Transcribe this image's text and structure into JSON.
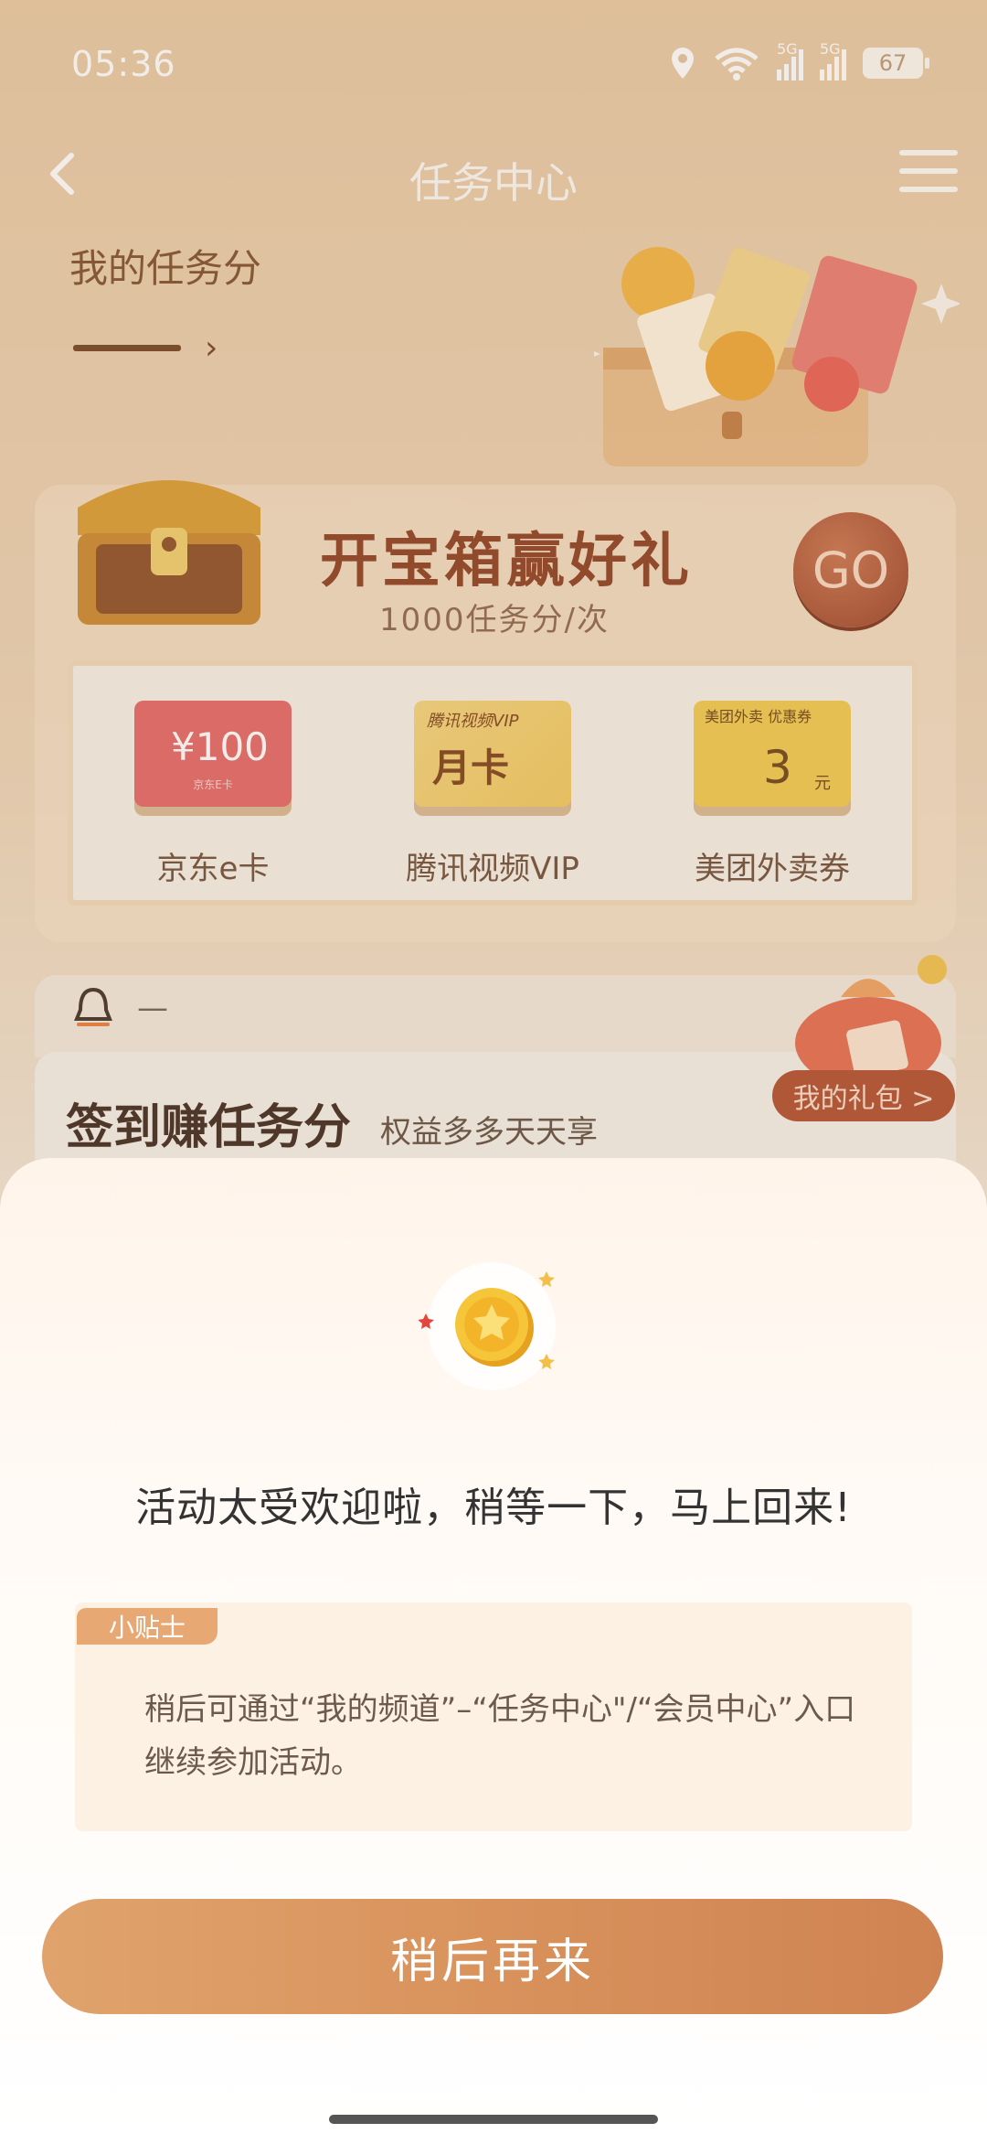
{
  "status_bar": {
    "time": "05:36",
    "battery": "67",
    "signal1": "5G",
    "signal2": "5G"
  },
  "nav": {
    "title": "任务中心"
  },
  "score": {
    "label": "我的任务分"
  },
  "treasure": {
    "title": "开宝箱赢好礼",
    "subtitle": "1000任务分/次",
    "go_label": "GO",
    "rewards": [
      {
        "label": "京东e卡",
        "card_value": "¥100",
        "card_note": "京东E卡"
      },
      {
        "label": "腾讯视频VIP",
        "card_top": "腾讯视频VIP",
        "card_value": "月卡"
      },
      {
        "label": "美团外卖券",
        "card_top": "美团外卖 优惠券",
        "card_value": "3",
        "card_unit": "元"
      }
    ]
  },
  "notice": {
    "text": "—"
  },
  "signin": {
    "title": "签到赚任务分",
    "subtitle": "权益多多天天享",
    "gift_button": "我的礼包 >"
  },
  "modal": {
    "message": "活动太受欢迎啦，稍等一下，马上回来!",
    "tip_tag": "小贴士",
    "tip_text": "稍后可通过“我的频道”–“任务中心\"/“会员中心”入口继续参加活动。",
    "button": "稍后再来"
  },
  "colors": {
    "accent": "#d9925c",
    "brand_brown": "#8a3a1c",
    "go_red": "#9a3e22"
  },
  "icons": [
    "location-icon",
    "wifi-icon",
    "signal-icon",
    "battery-icon",
    "back-icon",
    "menu-icon",
    "bell-icon",
    "coin-icon",
    "treasure-chest-icon",
    "gift-bag-icon"
  ]
}
